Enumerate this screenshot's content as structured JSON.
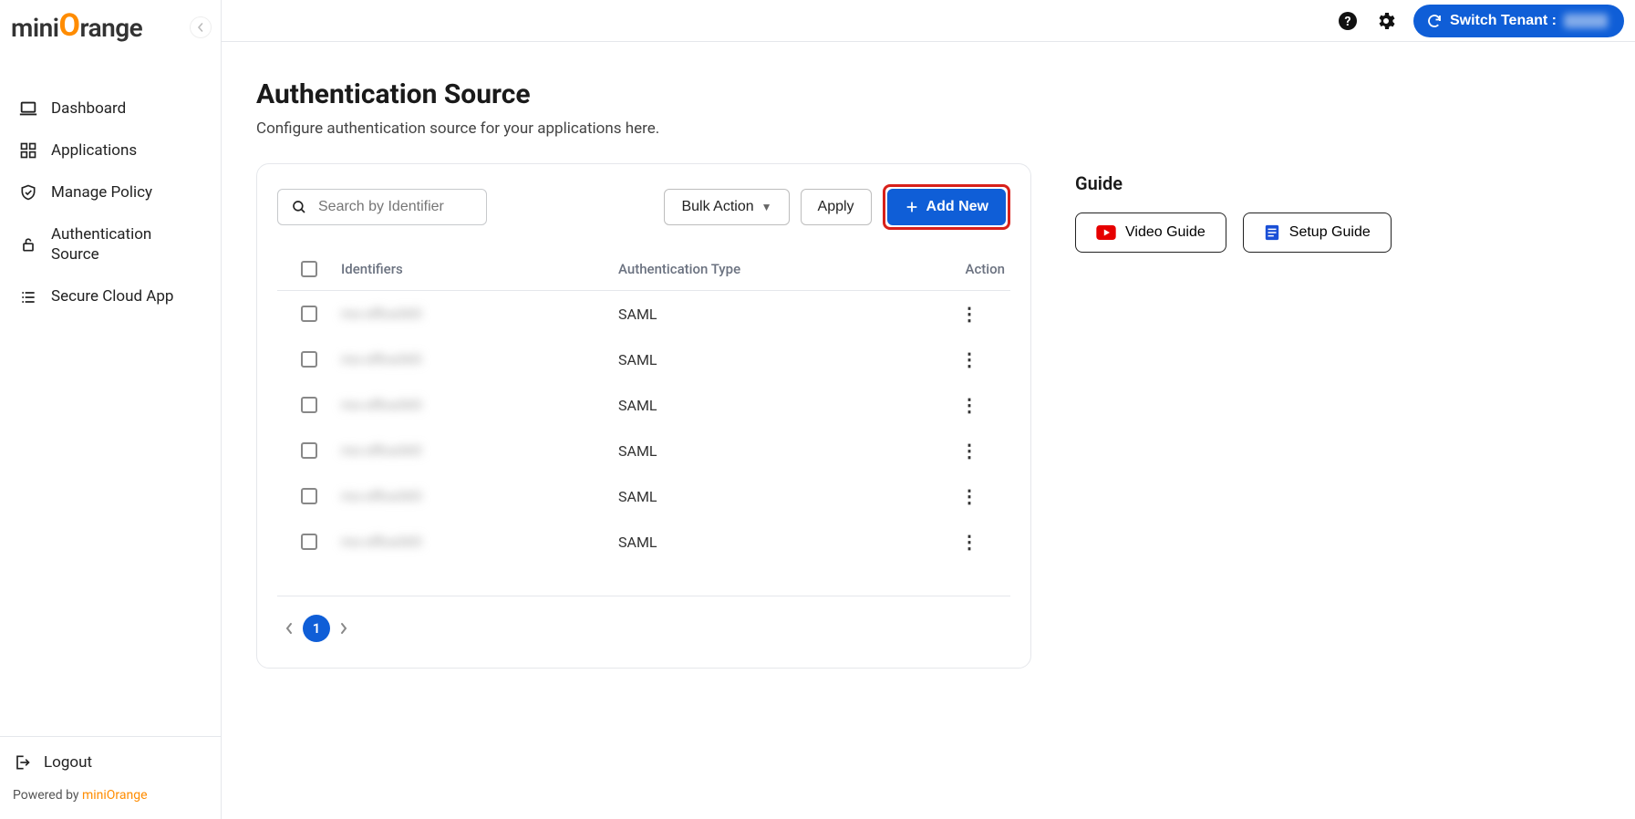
{
  "brand": {
    "name_pre": "mini",
    "name_post": "range"
  },
  "sidebar": {
    "items": [
      {
        "label": "Dashboard"
      },
      {
        "label": "Applications"
      },
      {
        "label": "Manage Policy"
      },
      {
        "label": "Authentication Source"
      },
      {
        "label": "Secure Cloud App"
      }
    ],
    "logout_label": "Logout",
    "powered_prefix": "Powered by ",
    "powered_link": "miniOrange"
  },
  "topbar": {
    "switch_tenant_label": "Switch Tenant :"
  },
  "page": {
    "title": "Authentication Source",
    "subtitle": "Configure authentication source for your applications here."
  },
  "toolbar": {
    "search_placeholder": "Search by Identifier",
    "bulk_action_label": "Bulk Action",
    "apply_label": "Apply",
    "add_new_label": "Add New"
  },
  "table": {
    "headers": {
      "identifiers": "Identifiers",
      "auth_type": "Authentication Type",
      "action": "Action"
    },
    "rows": [
      {
        "auth_type": "SAML"
      },
      {
        "auth_type": "SAML"
      },
      {
        "auth_type": "SAML"
      },
      {
        "auth_type": "SAML"
      },
      {
        "auth_type": "SAML"
      },
      {
        "auth_type": "SAML"
      }
    ]
  },
  "pagination": {
    "current": "1"
  },
  "guide": {
    "title": "Guide",
    "video_label": "Video Guide",
    "setup_label": "Setup Guide"
  }
}
